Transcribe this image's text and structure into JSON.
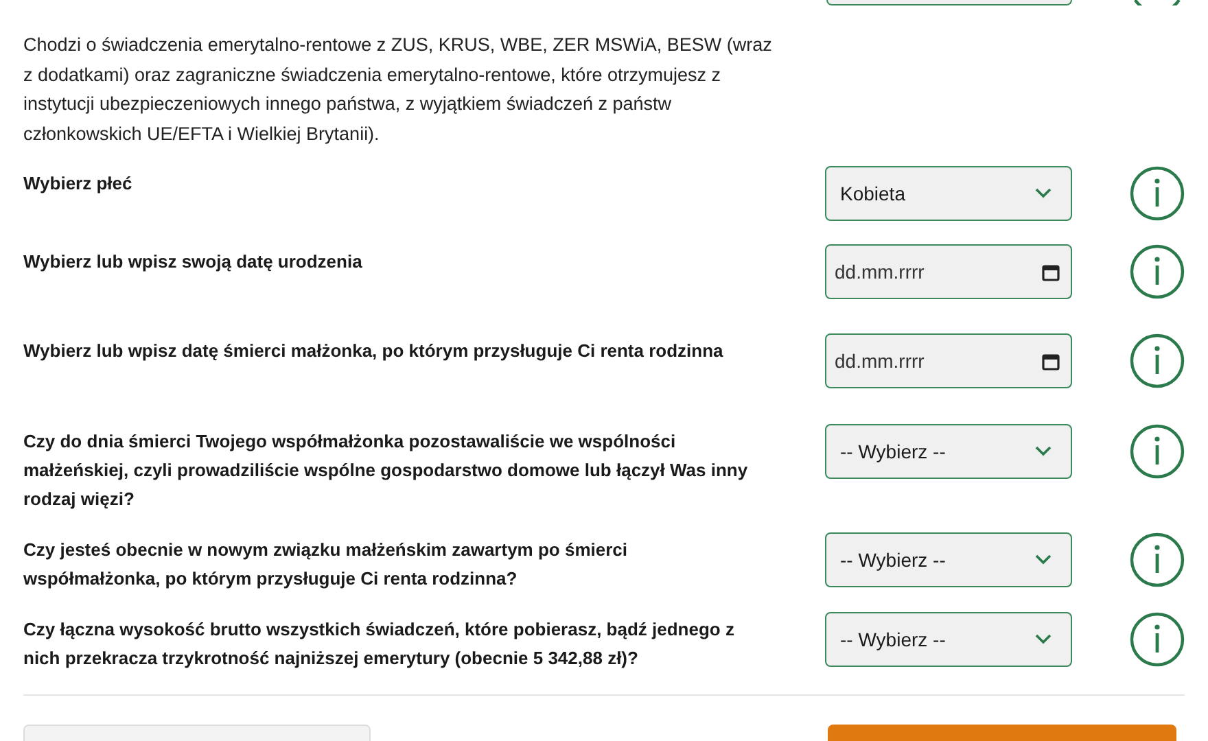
{
  "description": "Chodzi o świadczenia emerytalno-rentowe z ZUS, KRUS, WBE, ZER MSWiA, BESW (wraz z dodatkami) oraz zagraniczne świadczenia emerytalno-rentowe, które otrzymujesz z instytucji ubezpieczeniowych innego państwa, z wyjątkiem świadczeń z państw członkowskich UE/EFTA i Wielkiej Brytanii).",
  "questions": [
    {
      "kind": "select",
      "label": "Wybierz płeć",
      "value": "Kobieta"
    },
    {
      "kind": "date",
      "label": "Wybierz lub wpisz swoją datę urodzenia",
      "placeholder": "dd.mm.rrrr"
    },
    {
      "kind": "date",
      "label": "Wybierz lub wpisz datę śmierci małżonka, po którym przysługuje Ci renta rodzinna",
      "placeholder": "dd.mm.rrrr"
    },
    {
      "kind": "select",
      "label": "Czy do dnia śmierci Twojego współmałżonka pozostawaliście we wspólności małżeńskiej, czyli prowadziliście wspólne gospodarstwo domowe lub łączył Was inny rodzaj więzi?",
      "value": "-- Wybierz --"
    },
    {
      "kind": "select",
      "label": "Czy jesteś obecnie w nowym związku małżeńskim zawartym po śmierci współmałżonka, po którym przysługuje Ci renta rodzinna?",
      "value": "-- Wybierz --"
    },
    {
      "kind": "select",
      "label": "Czy łączna wysokość brutto wszystkich świadczeń, które pobierasz, bądź jednego z nich przekracza trzykrotność najniższej emerytury (obecnie 5 342,88 zł)?",
      "value": "-- Wybierz --"
    }
  ]
}
